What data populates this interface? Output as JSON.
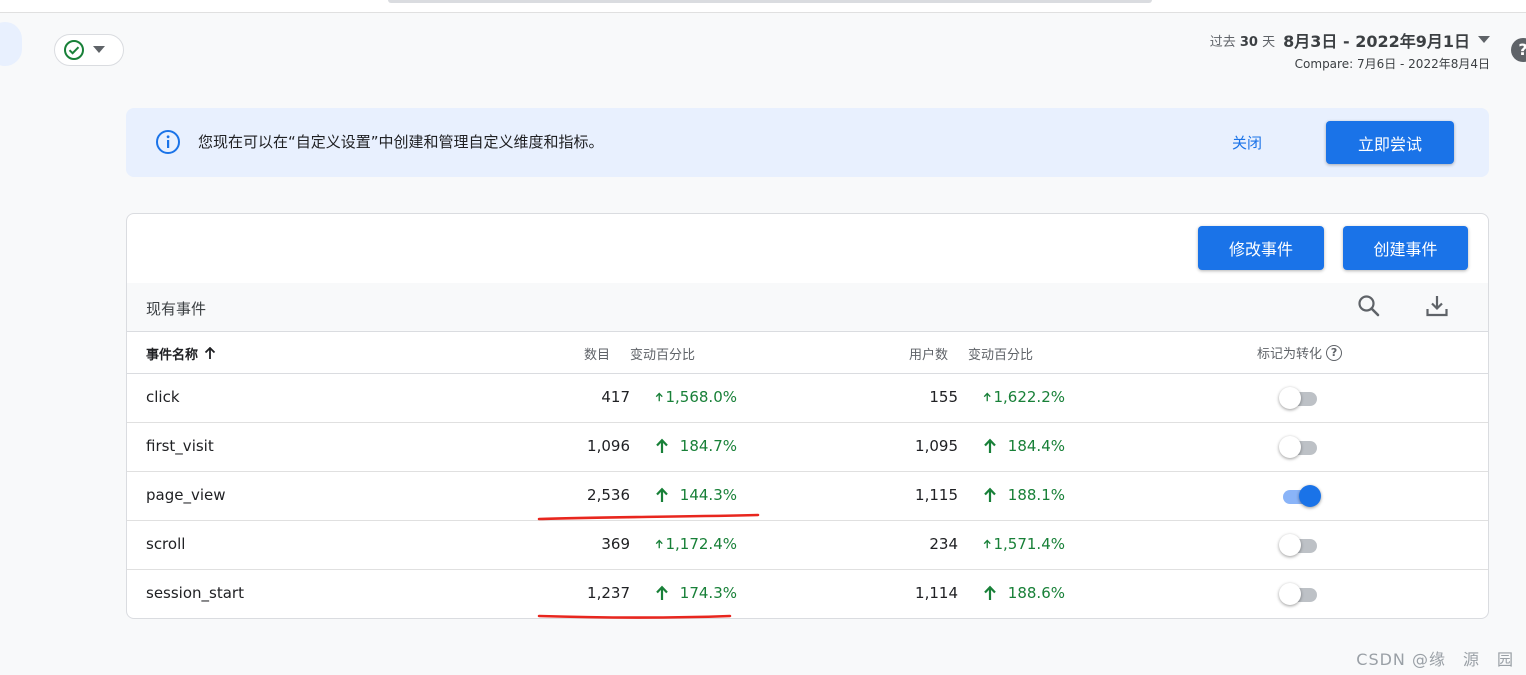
{
  "header": {
    "status_icon": "check-circle-icon",
    "date_prefix_a": "过去",
    "date_prefix_days": "30",
    "date_prefix_b": "天",
    "date_range": "8月3日 - 2022年9月1日",
    "compare": "Compare: 7月6日 - 2022年8月4日",
    "help_glyph": "?"
  },
  "banner": {
    "message": "您现在可以在“自定义设置”中创建和管理自定义维度和指标。",
    "close_label": "关闭",
    "try_label": "立即尝试"
  },
  "card": {
    "modify_label": "修改事件",
    "create_label": "创建事件",
    "section_title": "现有事件",
    "columns": {
      "name": "事件名称",
      "count": "数目",
      "count_change": "变动百分比",
      "users": "用户数",
      "users_change": "变动百分比",
      "mark_conversion": "标记为转化"
    },
    "rows": [
      {
        "name": "click",
        "count": "417",
        "count_change": "1,568.0%",
        "users": "155",
        "users_change": "1,622.2%",
        "conversion": false
      },
      {
        "name": "first_visit",
        "count": "1,096",
        "count_change": "184.7%",
        "users": "1,095",
        "users_change": "184.4%",
        "conversion": false
      },
      {
        "name": "page_view",
        "count": "2,536",
        "count_change": "144.3%",
        "users": "1,115",
        "users_change": "188.1%",
        "conversion": true
      },
      {
        "name": "scroll",
        "count": "369",
        "count_change": "1,172.4%",
        "users": "234",
        "users_change": "1,571.4%",
        "conversion": false
      },
      {
        "name": "session_start",
        "count": "1,237",
        "count_change": "174.3%",
        "users": "1,114",
        "users_change": "188.6%",
        "conversion": false
      }
    ]
  },
  "watermark": "CSDN @缘　源　园",
  "colors": {
    "accent": "#1a73e8",
    "positive": "#188038",
    "annotation": "#e8261e"
  }
}
